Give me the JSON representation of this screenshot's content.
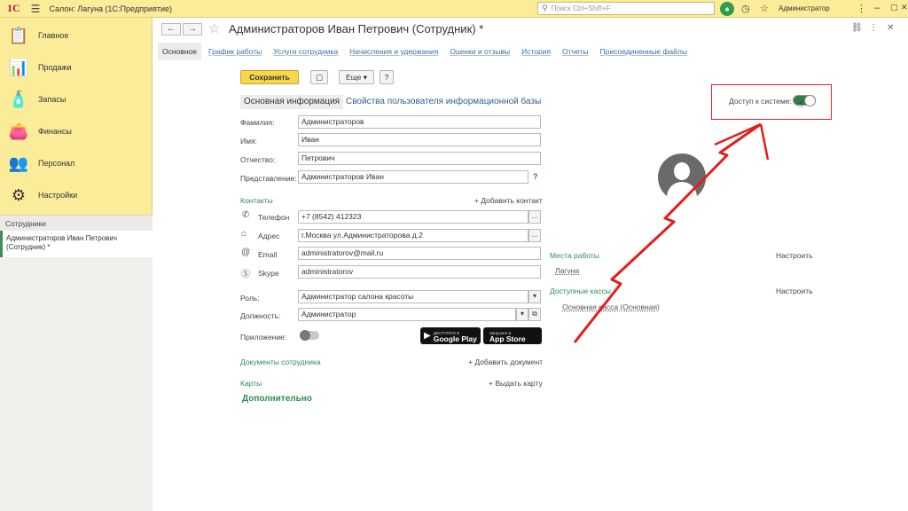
{
  "app": {
    "title": "Салон: Лагуна  (1С:Предприятие)",
    "logo": "1С",
    "search_placeholder": "Поиск Ctrl+Shift+F",
    "user": "Администратор"
  },
  "sidebar": {
    "items": [
      {
        "label": "Главное",
        "icon": "📋"
      },
      {
        "label": "Продажи",
        "icon": "📊"
      },
      {
        "label": "Запасы",
        "icon": "🧴"
      },
      {
        "label": "Финансы",
        "icon": "👛"
      },
      {
        "label": "Персонал",
        "icon": "👥"
      },
      {
        "label": "Настройки",
        "icon": "⚙"
      }
    ],
    "section_header": "Сотрудники",
    "open_window": "Администраторов Иван Петрович (Сотрудник) *"
  },
  "form": {
    "title": "Администраторов Иван Петрович (Сотрудник) *",
    "tabs": [
      "Основное",
      "График работы",
      "Услуги сотрудника",
      "Начисления и удержания",
      "Оценки и отзывы",
      "История",
      "Отчеты",
      "Присоединенные файлы"
    ],
    "save_label": "Сохранить",
    "more_label": "Еще",
    "help_label": "?",
    "subtabs": {
      "active": "Основная информация",
      "other": "Свойства пользователя информационной базы"
    },
    "fields": {
      "last_name": {
        "label": "Фамилия:",
        "value": "Администраторов"
      },
      "first_name": {
        "label": "Имя:",
        "value": "Иван"
      },
      "middle_name": {
        "label": "Отчество:",
        "value": "Петрович"
      },
      "display": {
        "label": "Представление:",
        "value": "Администраторов Иван"
      }
    },
    "contacts": {
      "header": "Контакты",
      "add": "+ Добавить контакт",
      "phone": {
        "label": "Телефон",
        "value": "+7 (8542) 412323"
      },
      "address": {
        "label": "Адрес",
        "value": "г.Москва ул.Администраторова д.2"
      },
      "email": {
        "label": "Email",
        "value": "administratorov@mail.ru"
      },
      "skype": {
        "label": "Skype",
        "value": "administratorov"
      }
    },
    "role": {
      "label": "Роль:",
      "value": "Администратор салона красоты"
    },
    "position": {
      "label": "Должность:",
      "value": "Администратор"
    },
    "app_label": "Приложение:",
    "stores": {
      "google": {
        "small": "ДОСТУПНО В",
        "big": "Google Play"
      },
      "apple": {
        "small": "Загрузите в",
        "big": "App Store"
      }
    },
    "documents": {
      "header": "Документы сотрудника",
      "add": "+ Добавить документ"
    },
    "cards": {
      "header": "Карты",
      "add": "+ Выдать карту"
    },
    "more_section": "Дополнительно",
    "access": {
      "label": "Доступ к системе:",
      "enabled": true
    },
    "workplaces": {
      "header": "Места работы",
      "configure": "Настроить",
      "item": "Лагуна"
    },
    "cashboxes": {
      "header": "Доступные кассы",
      "configure": "Настроить",
      "item": "Основная касса  (Основная)"
    }
  }
}
